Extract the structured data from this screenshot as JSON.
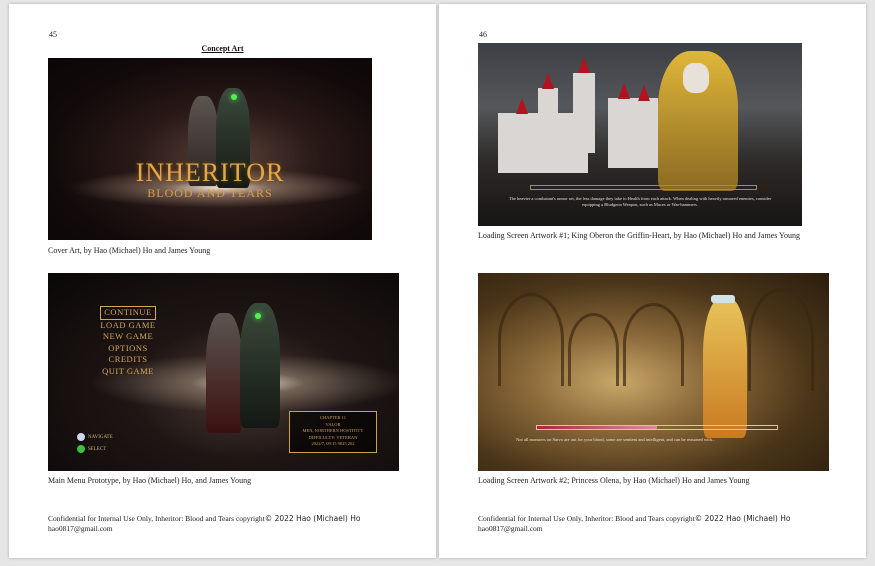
{
  "left_page": {
    "page_number": "45",
    "section_heading": "Concept Art",
    "cover": {
      "title": "INHERITOR",
      "subtitle": "BLOOD AND TEARS",
      "caption": "Cover Art, by Hao (Michael) Ho and James Young"
    },
    "menu": {
      "items": [
        "CONTINUE",
        "LOAD GAME",
        "NEW GAME",
        "OPTIONS",
        "CREDITS",
        "QUIT GAME"
      ],
      "save_info": [
        "CHAPTER 11",
        "VALOR",
        "MEN, NORTHERN HOSTITITY",
        "DIFFICULTY: VETERAN",
        "2022/7, 09:15 9825 202"
      ],
      "navigate_label": "NAVIGATE",
      "select_label": "SELECT",
      "caption": "Main Menu Prototype, by Hao (Michael) Ho, and James Young"
    },
    "footer": {
      "line1_prefix": "Confidential for Internal Use Only, Inheritor: Blood and Tears copyright",
      "line1_suffix": "© 2022 Hao (Michael) Ho",
      "line2": "hao0817@gmail.com"
    }
  },
  "right_page": {
    "page_number": "46",
    "oberon": {
      "loading_tip": "The heavier a combatant's armor set, the less damage they take to Health from each attack. When dealing with heavily armored enemies, consider equipping a Bludgeon Weapon, such as Maces or War-hammers.",
      "caption": "Loading Screen Artwork #1; King Oberon the Griffin-Heart, by Hao (Michael) Ho and James Young"
    },
    "olena": {
      "loading_tip": "Not all monsters on Sarvo are out for your blood, some are sentient and intelligent, and can be reasoned with...",
      "caption": "Loading Screen Artwork #2; Princess Olena, by Hao (Michael) Ho and James Young"
    },
    "footer": {
      "line1_prefix": "Confidential for Internal Use Only, Inheritor: Blood and Tears copyright",
      "line1_suffix": "© 2022 Hao (Michael) Ho",
      "line2": "hao0817@gmail.com"
    }
  },
  "colors": {
    "gold_text": "#d6a65a",
    "castle_roof_red": "#b3131e",
    "page_background": "#ffffff"
  }
}
